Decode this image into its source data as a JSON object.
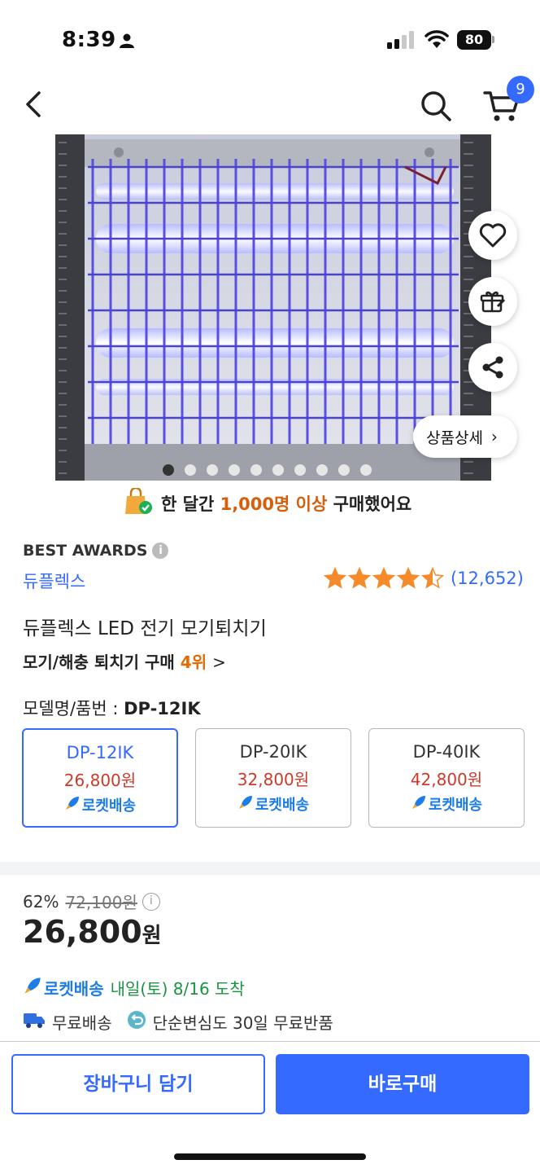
{
  "status_bar": {
    "time": "8:39",
    "battery": "80"
  },
  "cart_badge": "9",
  "detail_button": "상품상세",
  "carousel": {
    "count": 10,
    "active": 0
  },
  "purchase_note": {
    "prefix": "한 달간 ",
    "highlight": "1,000명 이상",
    "suffix": " 구매했어요"
  },
  "best_awards": "BEST AWARDS",
  "brand": "듀플렉스",
  "rating": {
    "stars": 4.5,
    "count": "(12,652)"
  },
  "title": "듀플렉스 LED 전기 모기퇴치기",
  "rank": {
    "prefix": "모기/해충 퇴치기 구매 ",
    "num": "4위",
    "chevron": ">"
  },
  "model": {
    "label": "모델명/품번 : ",
    "value": "DP-12IK"
  },
  "options": [
    {
      "name": "DP-12IK",
      "price": "26,800원",
      "shipping": "로켓배송"
    },
    {
      "name": "DP-20IK",
      "price": "32,800원",
      "shipping": "로켓배송"
    },
    {
      "name": "DP-40IK",
      "price": "42,800원",
      "shipping": "로켓배송"
    }
  ],
  "price": {
    "discount": "62%",
    "original": "72,100원",
    "current": "26,800",
    "currency": "원"
  },
  "delivery": {
    "rocket": "로켓배송",
    "eta": "내일(토) 8/16 도착"
  },
  "shipping": {
    "free": "무료배송",
    "returns": "단순변심도 30일 무료반품"
  },
  "buttons": {
    "cart": "장바구니 담기",
    "buy": "바로구매"
  },
  "colors": {
    "accent": "#346aff",
    "price_red": "#cc3a2a",
    "rocket_blue": "#1c7ce8",
    "delivery_green": "#1a9443",
    "rank_orange": "#e66a00"
  }
}
